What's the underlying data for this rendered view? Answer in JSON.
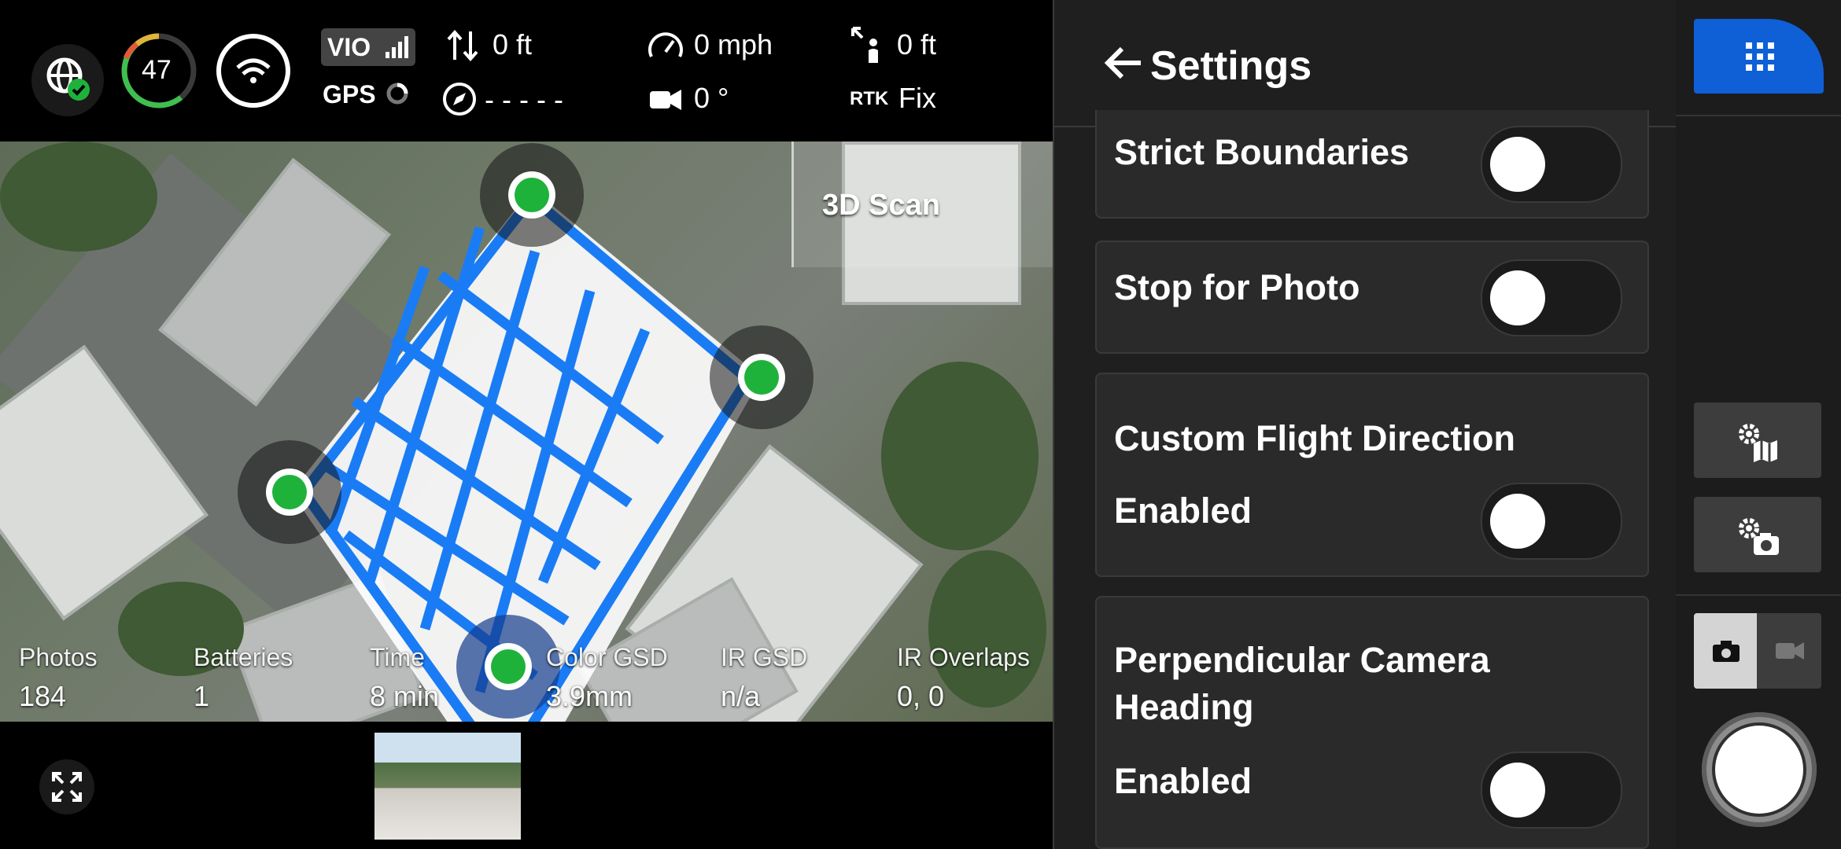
{
  "status_bar": {
    "battery_percent": "47",
    "vio_label": "VIO",
    "gps_label": "GPS",
    "vertical_speed": "0 ft",
    "heading": "- - - - -",
    "speed": "0 mph",
    "camera_angle": "0 °",
    "height": "0 ft",
    "rtk_label": "RTK",
    "rtk_status": "Fix"
  },
  "map": {
    "mission_label": "3D Scan",
    "route_color": "#1a7cf5",
    "waypoint_color": "#1fb23a",
    "stats": [
      {
        "label": "Photos",
        "value": "184"
      },
      {
        "label": "Batteries",
        "value": "1"
      },
      {
        "label": "Time",
        "value": "8 min"
      },
      {
        "label": "Color GSD",
        "value": "3.9mm"
      },
      {
        "label": "IR GSD",
        "value": "n/a"
      },
      {
        "label": "IR Overlaps",
        "value": "0, 0"
      }
    ]
  },
  "settings": {
    "title": "Settings",
    "items": [
      {
        "title": "Strict Boundaries",
        "sub": "",
        "enabled": false
      },
      {
        "title": "Stop for Photo",
        "sub": "",
        "enabled": false
      },
      {
        "title": "Custom Flight Direction",
        "sub": "Enabled",
        "enabled": false
      },
      {
        "title": "Perpendicular Camera Heading",
        "sub": "Enabled",
        "enabled": false
      }
    ]
  },
  "colors": {
    "accent_blue": "#0f5fd6",
    "battery_ring_green": "#3fbf4f",
    "gps_ok_green": "#1fb23a",
    "panel_bg": "#1f1f1f"
  },
  "icons": [
    "globe-check-icon",
    "wifi-icon",
    "signal-bars-icon",
    "gps-spinner-icon",
    "vertical-arrows-icon",
    "compass-icon",
    "speedometer-icon",
    "camera-angle-icon",
    "height-icon",
    "back-arrow-icon",
    "grid-apps-icon",
    "map-settings-icon",
    "camera-settings-icon",
    "camera-icon",
    "video-icon",
    "fullscreen-icon"
  ]
}
